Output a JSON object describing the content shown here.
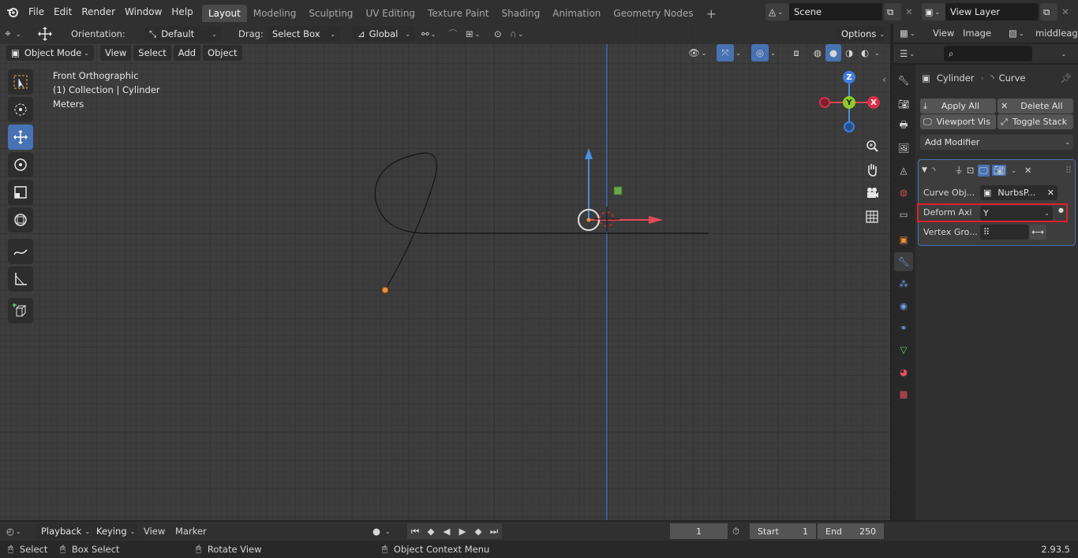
{
  "topbar": {
    "menus": [
      "File",
      "Edit",
      "Render",
      "Window",
      "Help"
    ],
    "workspaces": [
      "Layout",
      "Modeling",
      "Sculpting",
      "UV Editing",
      "Texture Paint",
      "Shading",
      "Animation",
      "Geometry Nodes"
    ],
    "active_workspace": "Layout",
    "scene": "Scene",
    "view_layer": "View Layer"
  },
  "tool_header": {
    "orientation_label": "Orientation:",
    "orientation_value": "Default",
    "drag_label": "Drag:",
    "drag_value": "Select Box",
    "transform_space": "Global",
    "options": "Options"
  },
  "viewport_header": {
    "mode": "Object Mode",
    "menus": [
      "View",
      "Select",
      "Add",
      "Object"
    ]
  },
  "viewport": {
    "view_name": "Front Orthographic",
    "collection_info": "(1) Collection | Cylinder",
    "units": "Meters",
    "gizmo": {
      "z": "Z",
      "y": "Y",
      "x": "X"
    }
  },
  "image_editor_header": {
    "view": "View",
    "image": "Image",
    "image_name": "middleage"
  },
  "properties": {
    "object_name": "Cylinder",
    "modifier_name": "Curve",
    "apply_all": "Apply All",
    "delete_all": "Delete All",
    "viewport_vis": "Viewport Vis",
    "toggle_stack": "Toggle Stack",
    "add_modifier": "Add Modifier",
    "curve_object_label": "Curve Obj...",
    "curve_object_value": "NurbsP...",
    "deform_axis_label": "Deform Axi",
    "deform_axis_value": "Y",
    "vertex_group_label": "Vertex Gro...",
    "highlight_color": "#e0202a"
  },
  "timeline": {
    "playback": "Playback",
    "keying": "Keying",
    "view": "View",
    "marker": "Marker",
    "current_frame": "1",
    "start_label": "Start",
    "start_value": "1",
    "end_label": "End",
    "end_value": "250"
  },
  "statusbar": {
    "select": "Select",
    "box_select": "Box Select",
    "rotate_view": "Rotate View",
    "context_menu": "Object Context Menu",
    "version": "2.93.5"
  }
}
